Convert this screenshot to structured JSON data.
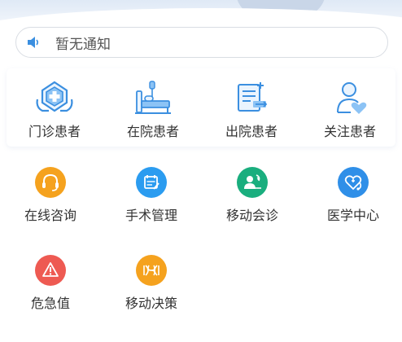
{
  "notice": {
    "text": "暂无通知"
  },
  "top_row": [
    {
      "label": "门诊患者",
      "icon": "outpatient-icon"
    },
    {
      "label": "在院患者",
      "icon": "inpatient-bed-icon"
    },
    {
      "label": "出院患者",
      "icon": "discharge-icon"
    },
    {
      "label": "关注患者",
      "icon": "follow-patient-icon"
    }
  ],
  "middle_row": [
    {
      "label": "在线咨询",
      "icon": "headset-icon",
      "color": "#f5a21e"
    },
    {
      "label": "手术管理",
      "icon": "calendar-edit-icon",
      "color": "#2b9cf0"
    },
    {
      "label": "移动会诊",
      "icon": "consultation-icon",
      "color": "#1aae7e"
    },
    {
      "label": "医学中心",
      "icon": "stethoscope-icon",
      "color": "#2f8fe8"
    }
  ],
  "bottom_row": [
    {
      "label": "危急值",
      "icon": "warning-icon",
      "color": "#ee5a52"
    },
    {
      "label": "移动决策",
      "icon": "dna-icon",
      "color": "#f5a21e"
    }
  ],
  "colors": {
    "primary_blue": "#3b8fe0",
    "light_blue": "#8cc3f5"
  }
}
